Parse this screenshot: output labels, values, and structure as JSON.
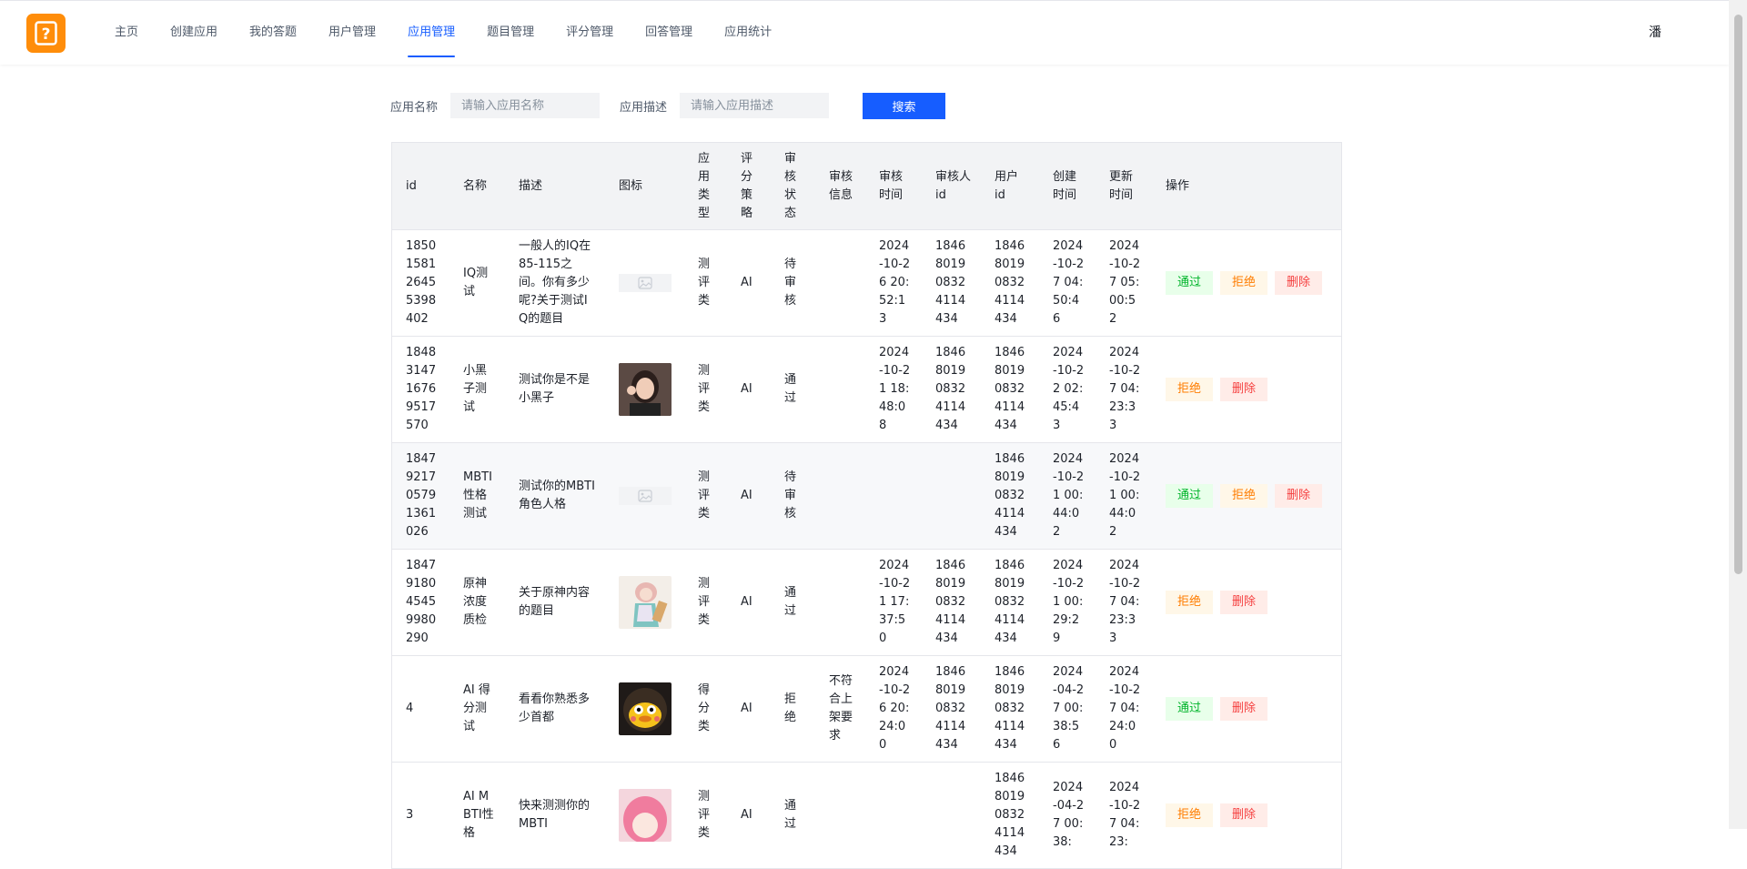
{
  "nav": {
    "items": [
      {
        "label": "主页",
        "active": false
      },
      {
        "label": "创建应用",
        "active": false
      },
      {
        "label": "我的答题",
        "active": false
      },
      {
        "label": "用户管理",
        "active": false
      },
      {
        "label": "应用管理",
        "active": true
      },
      {
        "label": "题目管理",
        "active": false
      },
      {
        "label": "评分管理",
        "active": false
      },
      {
        "label": "回答管理",
        "active": false
      },
      {
        "label": "应用统计",
        "active": false
      }
    ],
    "user": "潘"
  },
  "search": {
    "name_label": "应用名称",
    "name_placeholder": "请输入应用名称",
    "desc_label": "应用描述",
    "desc_placeholder": "请输入应用描述",
    "button": "搜索"
  },
  "table": {
    "headers": [
      "id",
      "名称",
      "描述",
      "图标",
      "应用类型",
      "评分策略",
      "审核状态",
      "审核信息",
      "审核时间",
      "审核人 id",
      "用户 id",
      "创建时间",
      "更新时间",
      "操作"
    ],
    "actions": {
      "pass": "通过",
      "reject": "拒绝",
      "delete": "删除"
    },
    "rows": [
      {
        "id": "1850158126455398402",
        "name": "IQ测试",
        "desc": "一般人的IQ在85-115之间。你有多少呢?关于测试IQ的题目",
        "icon": "placeholder",
        "appType": "测评类",
        "strategy": "AI",
        "status": "待审核",
        "reviewMsg": "",
        "reviewTime": "2024-10-26 20:52:13",
        "reviewerId": "1846801908324114434",
        "userId": "1846801908324114434",
        "createTime": "2024-10-27 04:50:46",
        "updateTime": "2024-10-27 05:00:52",
        "ops": [
          "pass",
          "reject",
          "delete"
        ]
      },
      {
        "id": "1848314716769517570",
        "name": "小黑子测试",
        "desc": "测试你是不是小黑子",
        "icon": "photo-girl",
        "appType": "测评类",
        "strategy": "AI",
        "status": "通过",
        "reviewMsg": "",
        "reviewTime": "2024-10-21 18:48:08",
        "reviewerId": "1846801908324114434",
        "userId": "1846801908324114434",
        "createTime": "2024-10-22 02:45:43",
        "updateTime": "2024-10-27 04:23:33",
        "ops": [
          "reject",
          "delete"
        ]
      },
      {
        "id": "1847921705791361026",
        "name": "MBTI性格测试",
        "desc": "测试你的MBTI角色人格",
        "icon": "placeholder",
        "appType": "测评类",
        "strategy": "AI",
        "status": "待审核",
        "reviewMsg": "",
        "reviewTime": "",
        "reviewerId": "",
        "userId": "1846801908324114434",
        "createTime": "2024-10-21 00:44:02",
        "updateTime": "2024-10-21 00:44:02",
        "ops": [
          "pass",
          "reject",
          "delete"
        ]
      },
      {
        "id": "1847918045459980290",
        "name": "原神浓度质检",
        "desc": "关于原神内容的题目",
        "icon": "anime-pink",
        "appType": "测评类",
        "strategy": "AI",
        "status": "通过",
        "reviewMsg": "",
        "reviewTime": "2024-10-21 17:37:50",
        "reviewerId": "1846801908324114434",
        "userId": "1846801908324114434",
        "createTime": "2024-10-21 00:29:29",
        "updateTime": "2024-10-27 04:23:33",
        "ops": [
          "reject",
          "delete"
        ]
      },
      {
        "id": "4",
        "name": "AI 得分测试",
        "desc": "看看你熟悉多少首都",
        "icon": "duck",
        "appType": "得分类",
        "strategy": "AI",
        "status": "拒绝",
        "reviewMsg": "不符合上架要求",
        "reviewTime": "2024-10-26 20:24:00",
        "reviewerId": "1846801908324114434",
        "userId": "1846801908324114434",
        "createTime": "2024-04-27 00:38:56",
        "updateTime": "2024-10-27 04:24:00",
        "ops": [
          "pass",
          "delete"
        ]
      },
      {
        "id": "3",
        "name": "AI MBTI性格",
        "desc": "快来测测你的MBTI",
        "icon": "pink-hair",
        "appType": "测评类",
        "strategy": "AI",
        "status": "通过",
        "reviewMsg": "",
        "reviewTime": "",
        "reviewerId": "",
        "userId": "1846801908324114434",
        "createTime": "2024-04-27 00:38:",
        "updateTime": "2024-10-27 04:23:",
        "ops": [
          "reject",
          "delete"
        ]
      }
    ]
  }
}
